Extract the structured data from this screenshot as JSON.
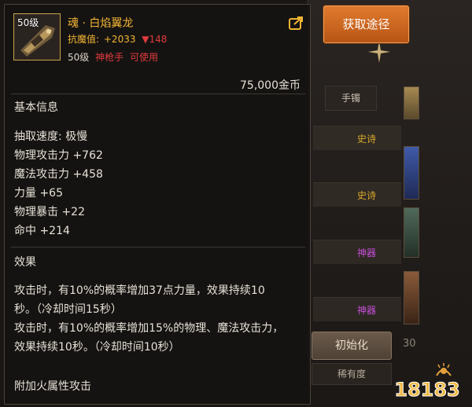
{
  "tooltip": {
    "level_badge": "50级",
    "item_name": "魂 · 白焰翼龙",
    "resist_label": "抗魔值:",
    "resist_value": "+2033",
    "resist_change": "▼148",
    "req_level": "50级",
    "req_class": "神枪手",
    "req_usable": "可使用",
    "price": "75,000金币",
    "basic_title": "基本信息",
    "stats": [
      "抽取速度: 极慢",
      "物理攻击力 +762",
      "魔法攻击力 +458",
      "力量 +65",
      "物理暴击 +22",
      "命中 +214"
    ],
    "effect_title": "效果",
    "effects": [
      "攻击时，有10%的概率增加37点力量，效果持续10",
      "秒。（冷却时间15秒）",
      "攻击时，有10%的概率增加15%的物理、魔法攻击力，",
      "效果持续10秒。（冷却时间10秒）"
    ],
    "extra": "附加火属性攻击"
  },
  "route_button": "获取途径",
  "background": {
    "tab_label": "手镯",
    "tags": [
      "史诗",
      "史诗",
      "神器",
      "神器"
    ],
    "init_button": "初始化",
    "sort_label": "稀有度",
    "side_number": "30"
  },
  "watermark_text": "18183",
  "colors": {
    "gold": "#f2b534",
    "red": "#e03b3b",
    "epic": "#d8a82a",
    "artifact": "#c64fd8",
    "route_button": "#d06a22"
  }
}
